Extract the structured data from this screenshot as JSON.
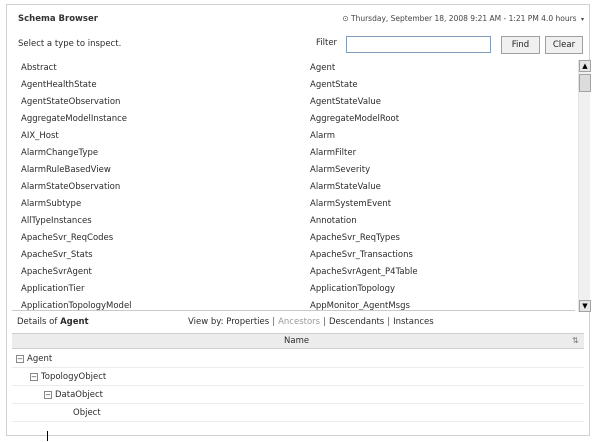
{
  "header": {
    "title": "Schema Browser",
    "timestamp": "Thursday, September 18, 2008 9:21 AM - 1:21 PM 4.0 hours"
  },
  "toolbar": {
    "hint": "Select a type to inspect.",
    "filter_label": "Filter",
    "filter_value": "",
    "find_label": "Find",
    "clear_label": "Clear"
  },
  "types": {
    "left": [
      "Abstract",
      "AgentHealthState",
      "AgentStateObservation",
      "AggregateModelInstance",
      "AIX_Host",
      "AlarmChangeType",
      "AlarmRuleBasedView",
      "AlarmStateObservation",
      "AlarmSubtype",
      "AllTypeInstances",
      "ApacheSvr_ReqCodes",
      "ApacheSvr_Stats",
      "ApacheSvrAgent",
      "ApplicationTier",
      "ApplicationTopologyModel"
    ],
    "right": [
      "Agent",
      "AgentState",
      "AgentStateValue",
      "AggregateModelRoot",
      "Alarm",
      "AlarmFilter",
      "AlarmSeverity",
      "AlarmStateValue",
      "AlarmSystemEvent",
      "Annotation",
      "ApacheSvr_ReqTypes",
      "ApacheSvr_Transactions",
      "ApacheSvrAgent_P4Table",
      "ApplicationTopology",
      "AppMonitor_AgentMsgs"
    ]
  },
  "details": {
    "prefix": "Details of",
    "selected": "Agent",
    "viewby_label": "View by:",
    "views": [
      "Properties",
      "Ancestors",
      "Descendants",
      "Instances"
    ],
    "column_name": "Name",
    "tree": [
      "Agent",
      "TopologyObject",
      "DataObject",
      "Object"
    ]
  },
  "icons": {
    "clock": "clock-icon",
    "scroll_up": "arrow-up-icon",
    "scroll_down": "arrow-down-icon",
    "tree_toggle": "collapse-minus-icon",
    "sort": "column-sort-icon"
  }
}
